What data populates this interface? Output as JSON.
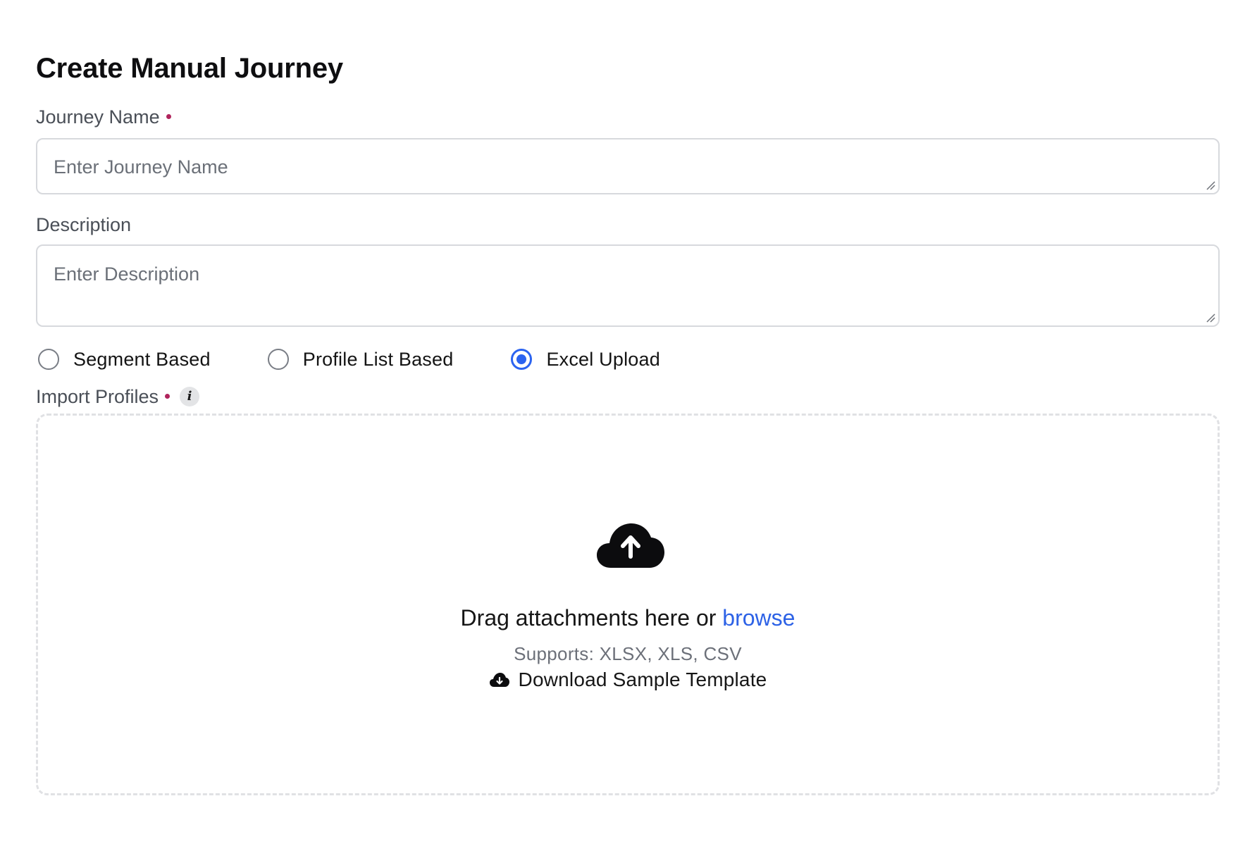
{
  "page": {
    "title": "Create Manual Journey"
  },
  "colors": {
    "required": "#b0245c",
    "accent": "#2b63f0",
    "link": "#2d62e6"
  },
  "form": {
    "journey_name": {
      "label": "Journey Name",
      "required": true,
      "placeholder": "Enter Journey Name",
      "value": ""
    },
    "description": {
      "label": "Description",
      "required": false,
      "placeholder": "Enter Description",
      "value": ""
    },
    "source_options": [
      {
        "label": "Segment Based",
        "selected": false
      },
      {
        "label": "Profile List Based",
        "selected": false
      },
      {
        "label": "Excel Upload",
        "selected": true
      }
    ],
    "import_profiles": {
      "label": "Import Profiles",
      "required": true,
      "info_icon": "info-icon",
      "info_glyph": "i"
    }
  },
  "dropzone": {
    "icon": "cloud-upload-icon",
    "drag_text": "Drag attachments here or ",
    "browse_text": "browse",
    "supports_text": "Supports: XLSX, XLS, CSV",
    "download_icon": "cloud-download-icon",
    "download_text": "Download Sample Template"
  }
}
